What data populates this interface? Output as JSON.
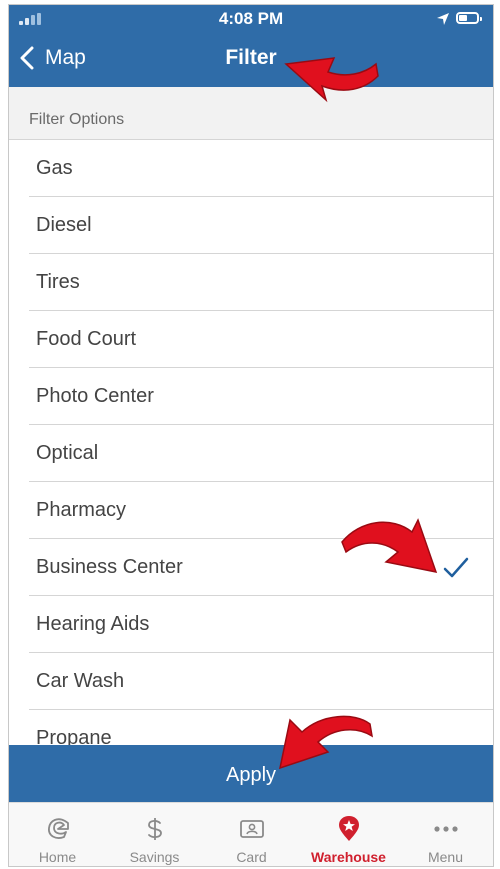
{
  "status_bar": {
    "time": "4:08 PM",
    "battery_level": 0.45
  },
  "header": {
    "back_label": "Map",
    "title": "Filter"
  },
  "section_title": "Filter Options",
  "filters": [
    {
      "label": "Gas",
      "checked": false
    },
    {
      "label": "Diesel",
      "checked": false
    },
    {
      "label": "Tires",
      "checked": false
    },
    {
      "label": "Food Court",
      "checked": false
    },
    {
      "label": "Photo Center",
      "checked": false
    },
    {
      "label": "Optical",
      "checked": false
    },
    {
      "label": "Pharmacy",
      "checked": false
    },
    {
      "label": "Business Center",
      "checked": true
    },
    {
      "label": "Hearing Aids",
      "checked": false
    },
    {
      "label": "Car Wash",
      "checked": false
    },
    {
      "label": "Propane",
      "checked": false
    }
  ],
  "apply_label": "Apply",
  "tabs": [
    {
      "label": "Home",
      "icon": "home-icon",
      "active": false
    },
    {
      "label": "Savings",
      "icon": "dollar-icon",
      "active": false
    },
    {
      "label": "Card",
      "icon": "card-icon",
      "active": false
    },
    {
      "label": "Warehouse",
      "icon": "warehouse-pin-icon",
      "active": true
    },
    {
      "label": "Menu",
      "icon": "more-dots-icon",
      "active": false
    }
  ],
  "colors": {
    "header_blue": "#2f6ca8",
    "active_red": "#d0202e",
    "check_blue": "#1f5f9e",
    "annotation_red": "#e0101e"
  }
}
